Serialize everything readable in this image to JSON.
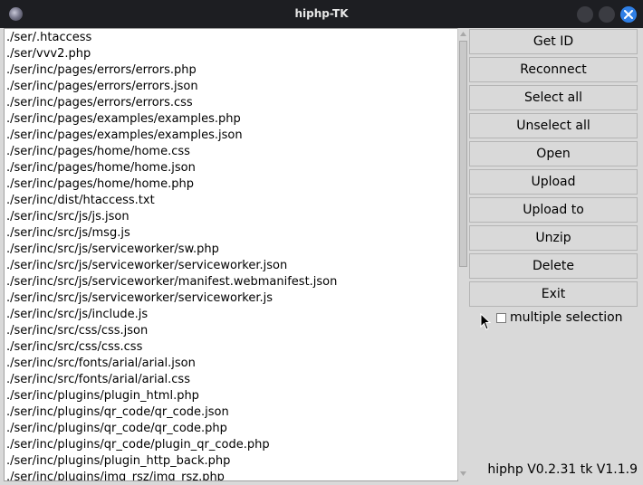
{
  "window": {
    "title": "hiphp-TK",
    "icons": [
      "app-icon",
      "minimize-icon",
      "maximize-icon",
      "close-icon"
    ]
  },
  "file_list": [
    "./ser/.htaccess",
    "./ser/vvv2.php",
    "./ser/inc/pages/errors/errors.php",
    "./ser/inc/pages/errors/errors.json",
    "./ser/inc/pages/errors/errors.css",
    "./ser/inc/pages/examples/examples.php",
    "./ser/inc/pages/examples/examples.json",
    "./ser/inc/pages/home/home.css",
    "./ser/inc/pages/home/home.json",
    "./ser/inc/pages/home/home.php",
    "./ser/inc/dist/htaccess.txt",
    "./ser/inc/src/js/js.json",
    "./ser/inc/src/js/msg.js",
    "./ser/inc/src/js/serviceworker/sw.php",
    "./ser/inc/src/js/serviceworker/serviceworker.json",
    "./ser/inc/src/js/serviceworker/manifest.webmanifest.json",
    "./ser/inc/src/js/serviceworker/serviceworker.js",
    "./ser/inc/src/js/include.js",
    "./ser/inc/src/css/css.json",
    "./ser/inc/src/css/css.css",
    "./ser/inc/src/fonts/arial/arial.json",
    "./ser/inc/src/fonts/arial/arial.css",
    "./ser/inc/plugins/plugin_html.php",
    "./ser/inc/plugins/qr_code/qr_code.json",
    "./ser/inc/plugins/qr_code/qr_code.php",
    "./ser/inc/plugins/qr_code/plugin_qr_code.php",
    "./ser/inc/plugins/plugin_http_back.php",
    "./ser/inc/plugins/img_rsz/img_rsz.php"
  ],
  "buttons": {
    "get_id": "Get ID",
    "reconnect": "Reconnect",
    "select_all": "Select all",
    "unselect_all": "Unselect all",
    "open": "Open",
    "upload": "Upload",
    "upload_to": "Upload to",
    "unzip": "Unzip",
    "delete": "Delete",
    "exit": "Exit"
  },
  "multiple_selection": {
    "label": "multiple selection",
    "checked": false
  },
  "version": "hiphp V0.2.31 tk V1.1.9",
  "colors": {
    "titlebar": "#1d1e22",
    "close_button": "#2f7fe6",
    "panel": "#d9d9d9",
    "list_background": "#ffffff"
  }
}
